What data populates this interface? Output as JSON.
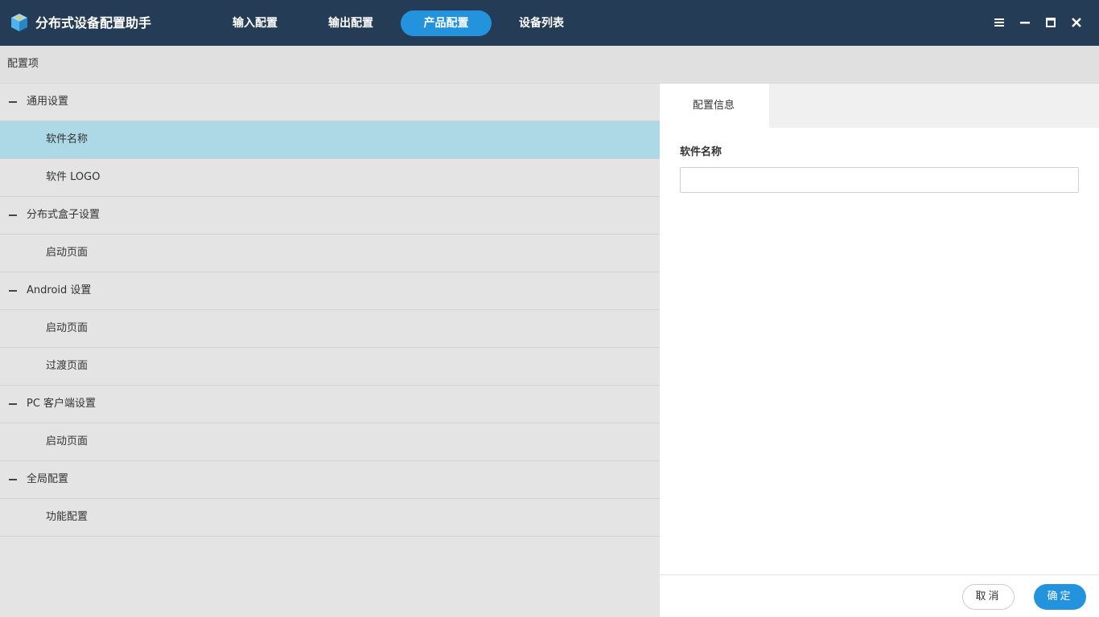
{
  "app": {
    "title": "分布式设备配置助手",
    "logo_icon": "cube-box-icon"
  },
  "nav": {
    "tabs": [
      {
        "label": "输入配置",
        "active": false
      },
      {
        "label": "输出配置",
        "active": false
      },
      {
        "label": "产品配置",
        "active": true
      },
      {
        "label": "设备列表",
        "active": false
      }
    ]
  },
  "window_controls": [
    "menu-icon",
    "minimize-icon",
    "maximize-icon",
    "close-icon"
  ],
  "config_header": {
    "label": "配置项"
  },
  "tree": [
    {
      "type": "group",
      "label": "通用设置",
      "expanded": true
    },
    {
      "type": "child",
      "label": "软件名称",
      "selected": true
    },
    {
      "type": "child",
      "label": "软件 LOGO"
    },
    {
      "type": "group",
      "label": "分布式盒子设置",
      "expanded": true
    },
    {
      "type": "child",
      "label": "启动页面"
    },
    {
      "type": "group",
      "label": "Android 设置",
      "expanded": true
    },
    {
      "type": "child",
      "label": "启动页面"
    },
    {
      "type": "child",
      "label": "过渡页面"
    },
    {
      "type": "group",
      "label": "PC 客户端设置",
      "expanded": true
    },
    {
      "type": "child",
      "label": "启动页面"
    },
    {
      "type": "group",
      "label": "全局配置",
      "expanded": true
    },
    {
      "type": "child",
      "label": "功能配置"
    }
  ],
  "panel": {
    "tab_label": "配置信息",
    "field_label": "软件名称",
    "field_value": "",
    "cancel_label": "取消",
    "ok_label": "确定"
  },
  "colors": {
    "titlebar": "#243c55",
    "accent": "#2393de",
    "selected_row": "#add8e6"
  }
}
